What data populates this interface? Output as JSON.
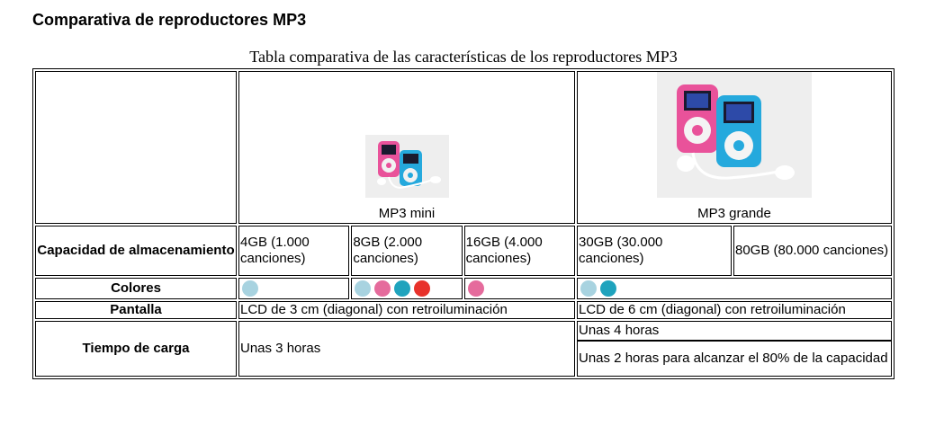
{
  "page": {
    "heading": "Comparativa de reproductores MP3"
  },
  "table": {
    "caption": "Tabla comparativa de las características de los reproductores MP3",
    "products": {
      "mini": {
        "label": "MP3 mini",
        "image_icon": "mp3-mini-product-photo"
      },
      "grande": {
        "label": "MP3 grande",
        "image_icon": "mp3-grande-product-photo"
      }
    },
    "rows": {
      "capacity": {
        "header": "Capacidad de almacenamiento",
        "mini": [
          "4GB (1.000 canciones)",
          "8GB (2.000 canciones)",
          "16GB (4.000 canciones)"
        ],
        "grande": [
          "30GB (30.000 canciones)",
          "80GB (80.000 canciones)"
        ]
      },
      "colors": {
        "header": "Colores",
        "mini_4gb": [
          "#a8d3e0"
        ],
        "mini_8gb": [
          "#a8d3e0",
          "#e56b9c",
          "#1fa3bd",
          "#e8322b"
        ],
        "mini_16gb": [
          "#e56b9c"
        ],
        "grande": [
          "#a8d3e0",
          "#1fa3bd"
        ]
      },
      "screen": {
        "header": "Pantalla",
        "mini": "LCD de 3 cm (diagonal) con retroiluminación",
        "grande": "LCD de 6 cm (diagonal) con retroiluminación"
      },
      "charge": {
        "header": "Tiempo de carga",
        "mini": "Unas 3 horas",
        "grande_full": "Unas 4 horas",
        "grande_partial": "Unas 2 horas para alcanzar el 80% de la capacidad"
      }
    }
  }
}
